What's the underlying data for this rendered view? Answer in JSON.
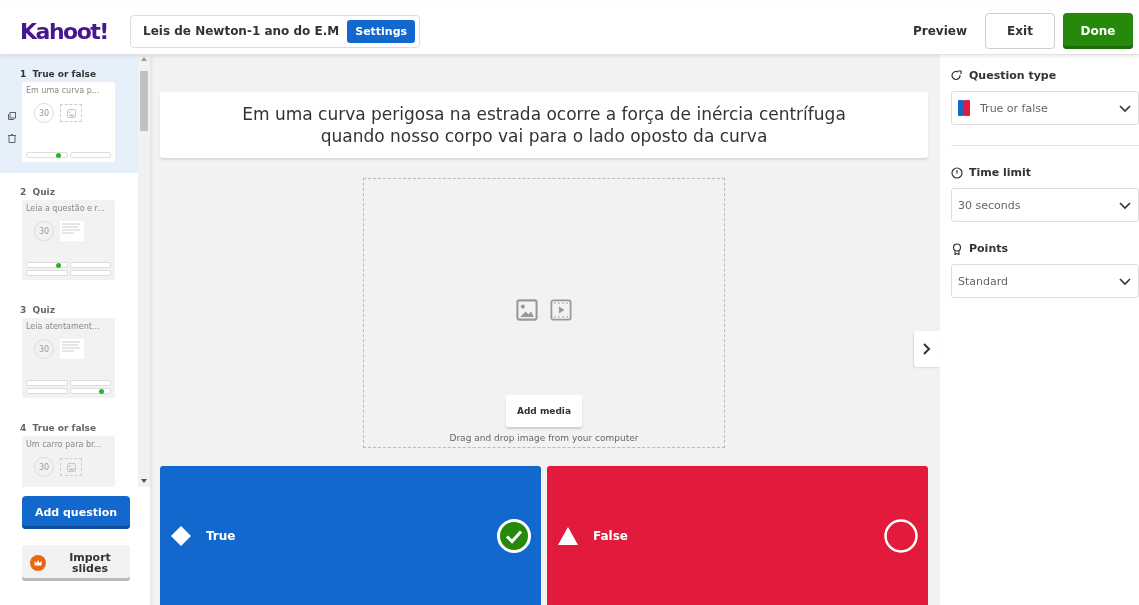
{
  "header": {
    "logo": "Kahoot!",
    "quiz_title": "Leis de Newton-1 ano do E.M",
    "settings_button": "Settings",
    "preview": "Preview",
    "exit": "Exit",
    "done": "Done"
  },
  "slides": [
    {
      "number": "1",
      "type": "True or false",
      "kind": "truefalse",
      "text": "Em uma curva p...",
      "timer": "30",
      "selected": true,
      "answer_slots": [
        true,
        false
      ]
    },
    {
      "number": "2",
      "type": "Quiz",
      "kind": "quiz",
      "text": "Leia a questão e r...",
      "timer": "30",
      "selected": false,
      "answer_slots": [
        true,
        false,
        false,
        false
      ]
    },
    {
      "number": "3",
      "type": "Quiz",
      "kind": "quiz",
      "text": "Leia atentament...",
      "timer": "30",
      "selected": false,
      "answer_slots": [
        false,
        false,
        false,
        true
      ]
    },
    {
      "number": "4",
      "type": "True or false",
      "kind": "truefalse",
      "text": "Um carro para br...",
      "timer": "30",
      "selected": false
    }
  ],
  "sidebar_buttons": {
    "add_question": "Add question",
    "import_slides": "Import slides"
  },
  "question": "Em uma curva perigosa na estrada ocorre a força de inércia centrífuga quando nosso corpo vai para o lado oposto da curva",
  "media": {
    "button": "Add media",
    "hint": "Drag and drop image from your computer"
  },
  "answers": [
    {
      "kind": "diamond",
      "label": "True",
      "correct": true
    },
    {
      "kind": "triangle",
      "label": "False",
      "correct": false
    }
  ],
  "settings": [
    {
      "kind": "type",
      "label": "Question type",
      "value": "True or false"
    },
    {
      "kind": "time",
      "label": "Time limit",
      "value": "30 seconds"
    },
    {
      "kind": "points",
      "label": "Points",
      "value": "Standard"
    }
  ]
}
